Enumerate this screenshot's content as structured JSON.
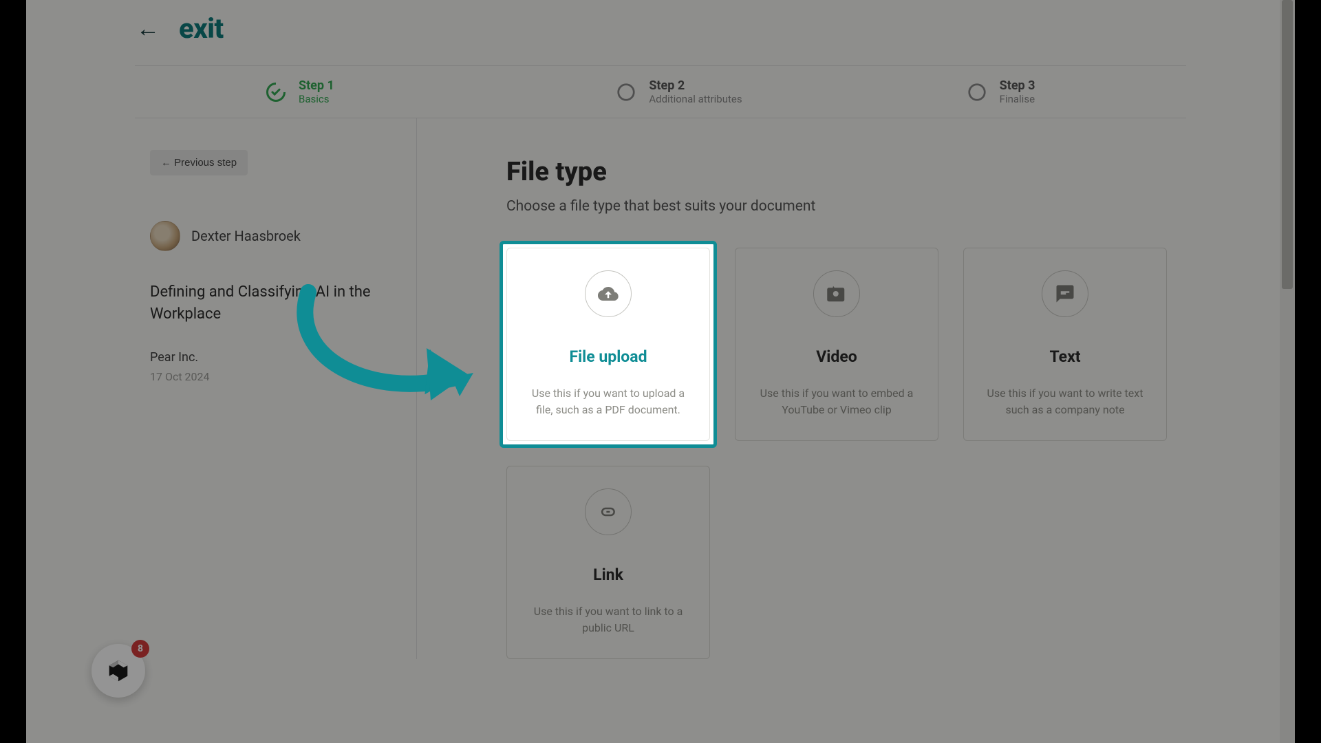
{
  "header": {
    "exit_label": "exit"
  },
  "stepper": {
    "steps": [
      {
        "title": "Step 1",
        "sub": "Basics",
        "state": "done"
      },
      {
        "title": "Step 2",
        "sub": "Additional attributes",
        "state": "pending"
      },
      {
        "title": "Step 3",
        "sub": "Finalise",
        "state": "pending"
      }
    ]
  },
  "sidebar": {
    "previous_button": "←  Previous step",
    "author_name": "Dexter Haasbroek",
    "document_title": "Defining and Classifying AI in the Workplace",
    "company": "Pear Inc.",
    "date": "17 Oct 2024"
  },
  "main": {
    "heading": "File type",
    "sub": "Choose a file type that best suits your document",
    "cards": [
      {
        "title": "File upload",
        "desc": "Use this if you want to upload a file, such as a PDF document.",
        "icon": "cloud-upload",
        "highlighted": true
      },
      {
        "title": "Video",
        "desc": "Use this if you want to embed a YouTube or Vimeo clip",
        "icon": "camera"
      },
      {
        "title": "Text",
        "desc": "Use this if you want to write text such as a company note",
        "icon": "chat"
      },
      {
        "title": "Link",
        "desc": "Use this if you want to link to a public URL",
        "icon": "link"
      }
    ]
  },
  "help": {
    "badge_count": "8"
  },
  "colors": {
    "accent_teal": "#0f8d95",
    "step_done_green": "#34a853",
    "badge_red": "#d23b3b"
  }
}
